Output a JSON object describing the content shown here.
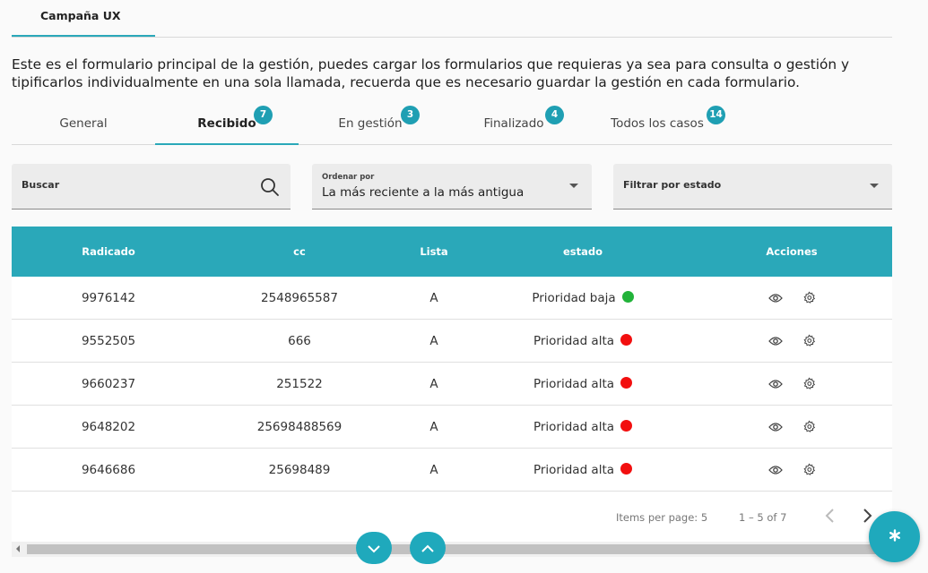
{
  "top_tab": {
    "label": "Campaña UX"
  },
  "intro": "Este es el formulario principal de la gestión, puedes cargar los formularios que requieras ya sea para consulta o gestión y tipificarlos individualmente en una sola llamada, recuerda que es necesario guardar la gestión en cada formulario.",
  "tabs": [
    {
      "label": "General",
      "badge": ""
    },
    {
      "label": "Recibido",
      "badge": "7"
    },
    {
      "label": "En gestión",
      "badge": "3"
    },
    {
      "label": "Finalizado",
      "badge": "4"
    },
    {
      "label": "Todos los casos",
      "badge": "14"
    }
  ],
  "active_tab": "Recibido",
  "search": {
    "label": "Buscar",
    "icon": "search-icon"
  },
  "sort": {
    "label": "Ordenar por",
    "value": "La más reciente a la más antigua"
  },
  "filter": {
    "label": "Filtrar por estado"
  },
  "table": {
    "headers": [
      "Radicado",
      "cc",
      "Lista",
      "estado",
      "Acciones"
    ],
    "rows": [
      {
        "radicado": "9976142",
        "cc": "2548965587",
        "lista": "A",
        "estado": "Prioridad baja",
        "color": "#22b33a"
      },
      {
        "radicado": "9552505",
        "cc": "666",
        "lista": "A",
        "estado": "Prioridad alta",
        "color": "#f20f0f"
      },
      {
        "radicado": "9660237",
        "cc": "251522",
        "lista": "A",
        "estado": "Prioridad alta",
        "color": "#f20f0f"
      },
      {
        "radicado": "9648202",
        "cc": "25698488569",
        "lista": "A",
        "estado": "Prioridad alta",
        "color": "#f20f0f"
      },
      {
        "radicado": "9646686",
        "cc": "25698489",
        "lista": "A",
        "estado": "Prioridad alta",
        "color": "#f20f0f"
      }
    ],
    "action_icons": [
      "eye-icon",
      "gear-icon"
    ]
  },
  "paginator": {
    "items_per_page": "Items per page: 5",
    "range": "1 – 5 of 7"
  },
  "colors": {
    "accent": "#2aa8b9",
    "badge": "#1f9fb3",
    "priority_low": "#22b33a",
    "priority_high": "#f20f0f"
  }
}
